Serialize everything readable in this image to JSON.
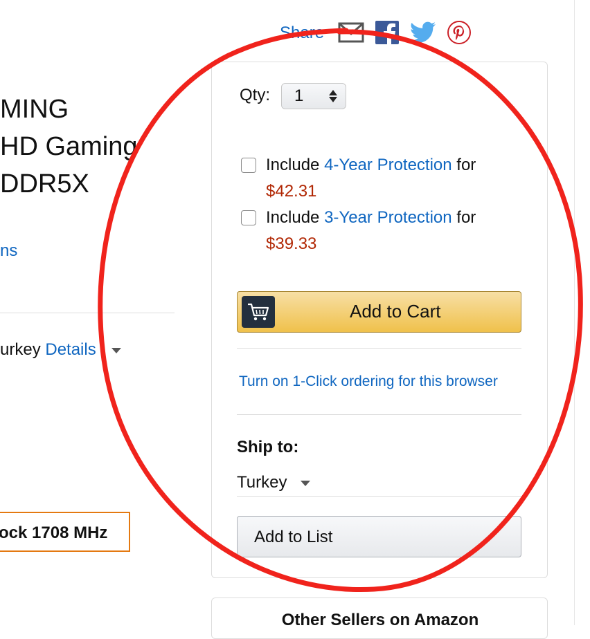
{
  "product": {
    "title_lines": [
      "MING",
      "HD Gaming",
      "DDR5X"
    ],
    "options_link": "ns",
    "deliver_prefix": "urkey",
    "deliver_link": "Details",
    "feature_badge": "ock 1708 MHz"
  },
  "share": {
    "label": "Share",
    "icons": [
      "email-icon",
      "facebook-icon",
      "twitter-icon",
      "pinterest-icon"
    ]
  },
  "buybox": {
    "qty_label": "Qty:",
    "qty_value": "1",
    "protection": [
      {
        "prefix": "Include ",
        "link": "4-Year Protection",
        "suffix": " for",
        "price": "$42.31"
      },
      {
        "prefix": "Include ",
        "link": "3-Year Protection",
        "suffix": " for",
        "price": "$39.33"
      }
    ],
    "add_to_cart": "Add to Cart",
    "one_click": "Turn on 1-Click ordering for this browser",
    "ship_to_label": "Ship to:",
    "ship_to_value": "Turkey",
    "add_to_list": "Add to List"
  },
  "other_sellers": {
    "title": "Other Sellers on Amazon"
  },
  "colors": {
    "link": "#0f66c0",
    "price": "#b12704",
    "cart_button": "#f0c14b",
    "annotation_circle": "#f0231c",
    "badge_border": "#e47911"
  }
}
